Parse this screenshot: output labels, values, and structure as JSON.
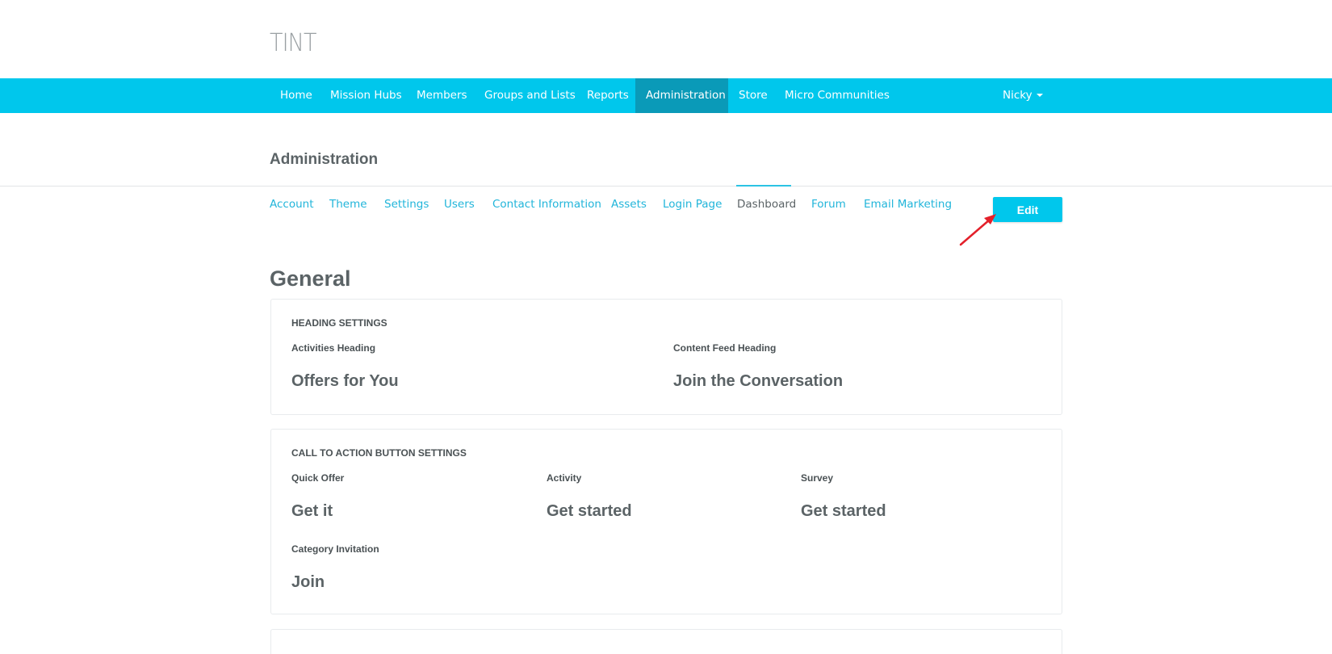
{
  "brand": {
    "logo_text": "TINT"
  },
  "topnav": {
    "items": [
      {
        "label": "Home"
      },
      {
        "label": "Mission Hubs"
      },
      {
        "label": "Members"
      },
      {
        "label": "Groups and Lists"
      },
      {
        "label": "Reports"
      },
      {
        "label": "Administration"
      },
      {
        "label": "Store"
      },
      {
        "label": "Micro Communities"
      }
    ],
    "user_label": "Nicky"
  },
  "page": {
    "title": "Administration"
  },
  "subnav": {
    "items": [
      {
        "label": "Account"
      },
      {
        "label": "Theme"
      },
      {
        "label": "Settings"
      },
      {
        "label": "Users"
      },
      {
        "label": "Contact Information"
      },
      {
        "label": "Assets"
      },
      {
        "label": "Login Page"
      },
      {
        "label": "Dashboard"
      },
      {
        "label": "Forum"
      },
      {
        "label": "Email Marketing"
      }
    ],
    "edit_label": "Edit"
  },
  "general": {
    "title": "General",
    "heading_settings": {
      "heading": "HEADING SETTINGS",
      "activities_label": "Activities Heading",
      "activities_value": "Offers for You",
      "content_feed_label": "Content Feed Heading",
      "content_feed_value": "Join the Conversation"
    },
    "cta_settings": {
      "heading": "CALL TO ACTION BUTTON SETTINGS",
      "quick_offer_label": "Quick Offer",
      "quick_offer_value": "Get it",
      "activity_label": "Activity",
      "activity_value": "Get started",
      "survey_label": "Survey",
      "survey_value": "Get started",
      "category_invitation_label": "Category Invitation",
      "category_invitation_value": "Join"
    }
  },
  "colors": {
    "nav_bg": "#00c7ec",
    "nav_active_bg": "#0a9ab8",
    "link": "#21b5da",
    "annotation_arrow": "#e3202a"
  }
}
